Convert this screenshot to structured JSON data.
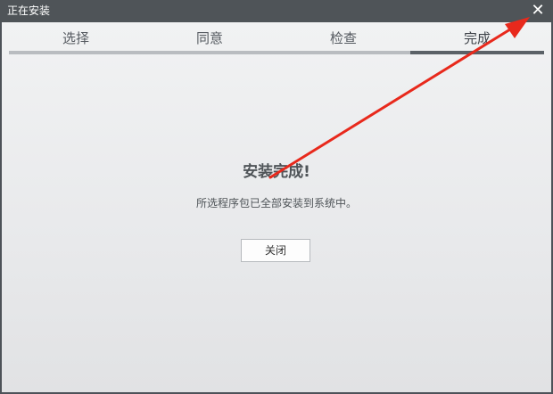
{
  "window": {
    "title": "正在安装",
    "close_glyph": "✕"
  },
  "steps": [
    {
      "label": "选择",
      "active": false
    },
    {
      "label": "同意",
      "active": false
    },
    {
      "label": "检查",
      "active": false
    },
    {
      "label": "完成",
      "active": true
    }
  ],
  "main": {
    "heading": "安装完成!",
    "message": "所选程序包已全部安装到系统中。",
    "close_button_label": "关闭"
  },
  "annotation": {
    "arrow_color": "#e8291c"
  },
  "colors": {
    "titlebar": "#4f5458",
    "active_step_bar": "#5b6167",
    "inactive_step_bar": "#b9bcc0"
  }
}
